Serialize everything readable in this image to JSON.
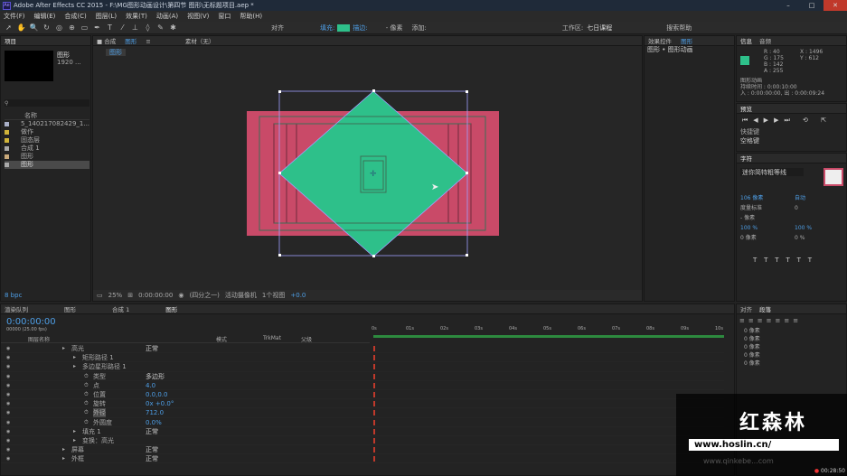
{
  "window": {
    "title": "Adobe After Effects CC 2015 - F:\\MG图形动画设计\\第四节 图形\\无标题项目.aep *"
  },
  "menu": [
    "文件(F)",
    "编辑(E)",
    "合成(C)",
    "图层(L)",
    "效果(T)",
    "动画(A)",
    "视图(V)",
    "窗口",
    "帮助(H)"
  ],
  "toolbar": {
    "align": "对齐",
    "fill_label": "填充:",
    "stroke_label": "描边:",
    "stroke_width": "- 像素",
    "add": "添加:",
    "workspace_label": "工作区:",
    "workspace": "七日课程",
    "search": "搜索帮助"
  },
  "colors": {
    "fill": "#2ec08a",
    "comp_bg": "#c94a68",
    "accent": "#4e9fe7"
  },
  "project": {
    "tab": "项目",
    "selected_name": "图形",
    "selected_info": "1920 ...",
    "col_name": "名称",
    "items": [
      {
        "name": "5_140217082429_1...",
        "color": "#a9b0c8"
      },
      {
        "name": "做作",
        "color": "#d0b43a"
      },
      {
        "name": "固态层",
        "color": "#d0b43a"
      },
      {
        "name": "合成 1",
        "color": "#a9a9a9"
      },
      {
        "name": "图形",
        "color": "#c9a97a"
      },
      {
        "name": "图形",
        "color": "#a9a9a9"
      }
    ],
    "bpc": "8 bpc"
  },
  "comp": {
    "tabs": [
      "合成",
      "图形",
      "素材（无）"
    ],
    "breadcrumb": "图形",
    "zoom": "25%",
    "timecode": "0:00:00:00",
    "resolution": "(四分之一)",
    "camera": "活动摄像机",
    "views": "1个视图",
    "offset": "+0.0"
  },
  "effects": {
    "tab": "效果控件",
    "tab2": "图形",
    "title": "图形 • 图形动画"
  },
  "info": {
    "tabs": [
      "信息",
      "音频"
    ],
    "rgb": [
      "R : 40",
      "G : 175",
      "B : 142",
      "A : 255"
    ],
    "xy": [
      "X : 1496",
      "Y : 612"
    ],
    "layer": "图形动画",
    "duration": "持续时间 : 0:00:10:00",
    "in_point": "入 : 0:00:00:00, 出 : 0:00:09:24"
  },
  "preview": {
    "tab": "预览",
    "shortcut_label": "快捷键",
    "shortcut": "空格键"
  },
  "character": {
    "tab": "字符",
    "font": "迷你简特粗等线",
    "size": "106 像素",
    "leading": "自动",
    "kerning": "度量标准",
    "tracking": "0",
    "stroke": "- 像素",
    "vscale": "100 %",
    "hscale": "100 %",
    "baseline": "0 像素",
    "tsume": "0 %"
  },
  "paragraph": {
    "tabs": [
      "对齐",
      "段落"
    ],
    "vals": [
      "0 像素",
      "0 像素",
      "0 像素",
      "0 像素",
      "0 像素"
    ]
  },
  "timeline": {
    "tabs": [
      "渲染队列",
      "图形",
      "合成 1",
      "图形"
    ],
    "timecode": "0:00:00:00",
    "fps": "00000 (25.00 fps)",
    "col_name": "图层名称",
    "col_mode": "模式",
    "col_trkmat": "TrkMat",
    "col_parent": "父级",
    "ruler": [
      "0s",
      "01s",
      "02s",
      "03s",
      "04s",
      "05s",
      "06s",
      "07s",
      "08s",
      "09s",
      "10s"
    ],
    "rows": [
      {
        "label": "高光",
        "value": "正常",
        "indent": 0
      },
      {
        "label": "矩形路径 1",
        "value": "",
        "indent": 1
      },
      {
        "label": "多边星形路径 1",
        "value": "",
        "indent": 1
      },
      {
        "label": "类型",
        "value": "多边形",
        "indent": 2
      },
      {
        "label": "点",
        "value": "4.0",
        "indent": 2
      },
      {
        "label": "位置",
        "value": "0.0,0.0",
        "indent": 2
      },
      {
        "label": "旋转",
        "value": "0x +0.0°",
        "indent": 2
      },
      {
        "label": "外径",
        "value": "712.0",
        "indent": 2
      },
      {
        "label": "外圆度",
        "value": "0.0%",
        "indent": 2
      },
      {
        "label": "填充 1",
        "value": "正常",
        "indent": 1
      },
      {
        "label": "变换：高光",
        "value": "",
        "indent": 1
      },
      {
        "label": "屏幕",
        "value": "正常",
        "indent": 0
      },
      {
        "label": "外框",
        "value": "正常",
        "indent": 0
      }
    ]
  },
  "watermark": {
    "brand": "红森林",
    "url": "www.hoslin.cn/",
    "clock": "00:28:50",
    "faint": "www.qinkebe...com"
  }
}
